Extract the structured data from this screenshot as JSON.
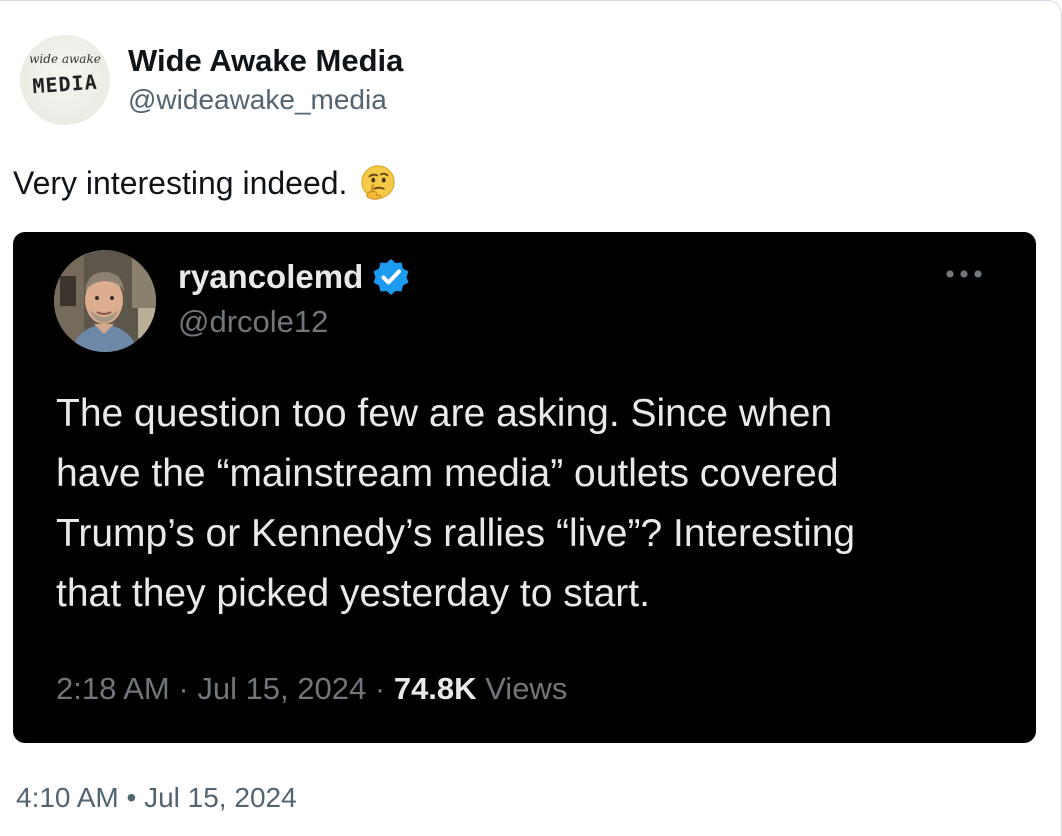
{
  "post": {
    "author_name": "Wide Awake Media",
    "author_handle": "@wideawake_media",
    "avatar_logo_top": "wide awake",
    "avatar_logo_main": "MEDIA",
    "text": "Very interesting indeed.",
    "text_emoji": "thinking-face-icon",
    "timestamp": "4:10 AM • Jul 15, 2024"
  },
  "quote": {
    "author_name": "ryancolemd",
    "author_handle": "@drcole12",
    "verified": true,
    "verified_color": "#1d9bf0",
    "body_lines": [
      "The question too few are asking. Since when",
      "have the “mainstream media” outlets covered",
      "Trump’s or Kennedy’s rallies “live”? Interesting",
      "that they picked yesterday to start."
    ],
    "time": "2:18 AM",
    "date": "Jul 15, 2024",
    "separator": "·",
    "views_count": "74.8K",
    "views_label": "Views"
  },
  "colors": {
    "background": "#ffffff",
    "quote_background": "#000000",
    "primary_text": "#0f1419",
    "secondary_text": "#536471",
    "dark_primary_text": "#e7e9ea",
    "dark_secondary_text": "#71767b"
  }
}
